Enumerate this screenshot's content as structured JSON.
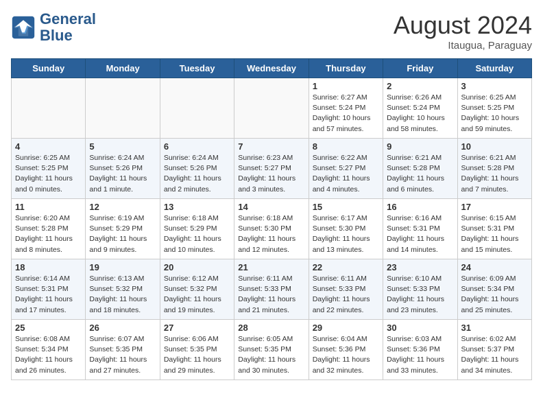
{
  "header": {
    "logo_line1": "General",
    "logo_line2": "Blue",
    "month_title": "August 2024",
    "location": "Itaugua, Paraguay"
  },
  "days_of_week": [
    "Sunday",
    "Monday",
    "Tuesday",
    "Wednesday",
    "Thursday",
    "Friday",
    "Saturday"
  ],
  "weeks": [
    [
      {
        "day": "",
        "info": ""
      },
      {
        "day": "",
        "info": ""
      },
      {
        "day": "",
        "info": ""
      },
      {
        "day": "",
        "info": ""
      },
      {
        "day": "1",
        "info": "Sunrise: 6:27 AM\nSunset: 5:24 PM\nDaylight: 10 hours\nand 57 minutes."
      },
      {
        "day": "2",
        "info": "Sunrise: 6:26 AM\nSunset: 5:24 PM\nDaylight: 10 hours\nand 58 minutes."
      },
      {
        "day": "3",
        "info": "Sunrise: 6:25 AM\nSunset: 5:25 PM\nDaylight: 10 hours\nand 59 minutes."
      }
    ],
    [
      {
        "day": "4",
        "info": "Sunrise: 6:25 AM\nSunset: 5:25 PM\nDaylight: 11 hours\nand 0 minutes."
      },
      {
        "day": "5",
        "info": "Sunrise: 6:24 AM\nSunset: 5:26 PM\nDaylight: 11 hours\nand 1 minute."
      },
      {
        "day": "6",
        "info": "Sunrise: 6:24 AM\nSunset: 5:26 PM\nDaylight: 11 hours\nand 2 minutes."
      },
      {
        "day": "7",
        "info": "Sunrise: 6:23 AM\nSunset: 5:27 PM\nDaylight: 11 hours\nand 3 minutes."
      },
      {
        "day": "8",
        "info": "Sunrise: 6:22 AM\nSunset: 5:27 PM\nDaylight: 11 hours\nand 4 minutes."
      },
      {
        "day": "9",
        "info": "Sunrise: 6:21 AM\nSunset: 5:28 PM\nDaylight: 11 hours\nand 6 minutes."
      },
      {
        "day": "10",
        "info": "Sunrise: 6:21 AM\nSunset: 5:28 PM\nDaylight: 11 hours\nand 7 minutes."
      }
    ],
    [
      {
        "day": "11",
        "info": "Sunrise: 6:20 AM\nSunset: 5:28 PM\nDaylight: 11 hours\nand 8 minutes."
      },
      {
        "day": "12",
        "info": "Sunrise: 6:19 AM\nSunset: 5:29 PM\nDaylight: 11 hours\nand 9 minutes."
      },
      {
        "day": "13",
        "info": "Sunrise: 6:18 AM\nSunset: 5:29 PM\nDaylight: 11 hours\nand 10 minutes."
      },
      {
        "day": "14",
        "info": "Sunrise: 6:18 AM\nSunset: 5:30 PM\nDaylight: 11 hours\nand 12 minutes."
      },
      {
        "day": "15",
        "info": "Sunrise: 6:17 AM\nSunset: 5:30 PM\nDaylight: 11 hours\nand 13 minutes."
      },
      {
        "day": "16",
        "info": "Sunrise: 6:16 AM\nSunset: 5:31 PM\nDaylight: 11 hours\nand 14 minutes."
      },
      {
        "day": "17",
        "info": "Sunrise: 6:15 AM\nSunset: 5:31 PM\nDaylight: 11 hours\nand 15 minutes."
      }
    ],
    [
      {
        "day": "18",
        "info": "Sunrise: 6:14 AM\nSunset: 5:31 PM\nDaylight: 11 hours\nand 17 minutes."
      },
      {
        "day": "19",
        "info": "Sunrise: 6:13 AM\nSunset: 5:32 PM\nDaylight: 11 hours\nand 18 minutes."
      },
      {
        "day": "20",
        "info": "Sunrise: 6:12 AM\nSunset: 5:32 PM\nDaylight: 11 hours\nand 19 minutes."
      },
      {
        "day": "21",
        "info": "Sunrise: 6:11 AM\nSunset: 5:33 PM\nDaylight: 11 hours\nand 21 minutes."
      },
      {
        "day": "22",
        "info": "Sunrise: 6:11 AM\nSunset: 5:33 PM\nDaylight: 11 hours\nand 22 minutes."
      },
      {
        "day": "23",
        "info": "Sunrise: 6:10 AM\nSunset: 5:33 PM\nDaylight: 11 hours\nand 23 minutes."
      },
      {
        "day": "24",
        "info": "Sunrise: 6:09 AM\nSunset: 5:34 PM\nDaylight: 11 hours\nand 25 minutes."
      }
    ],
    [
      {
        "day": "25",
        "info": "Sunrise: 6:08 AM\nSunset: 5:34 PM\nDaylight: 11 hours\nand 26 minutes."
      },
      {
        "day": "26",
        "info": "Sunrise: 6:07 AM\nSunset: 5:35 PM\nDaylight: 11 hours\nand 27 minutes."
      },
      {
        "day": "27",
        "info": "Sunrise: 6:06 AM\nSunset: 5:35 PM\nDaylight: 11 hours\nand 29 minutes."
      },
      {
        "day": "28",
        "info": "Sunrise: 6:05 AM\nSunset: 5:35 PM\nDaylight: 11 hours\nand 30 minutes."
      },
      {
        "day": "29",
        "info": "Sunrise: 6:04 AM\nSunset: 5:36 PM\nDaylight: 11 hours\nand 32 minutes."
      },
      {
        "day": "30",
        "info": "Sunrise: 6:03 AM\nSunset: 5:36 PM\nDaylight: 11 hours\nand 33 minutes."
      },
      {
        "day": "31",
        "info": "Sunrise: 6:02 AM\nSunset: 5:37 PM\nDaylight: 11 hours\nand 34 minutes."
      }
    ]
  ]
}
